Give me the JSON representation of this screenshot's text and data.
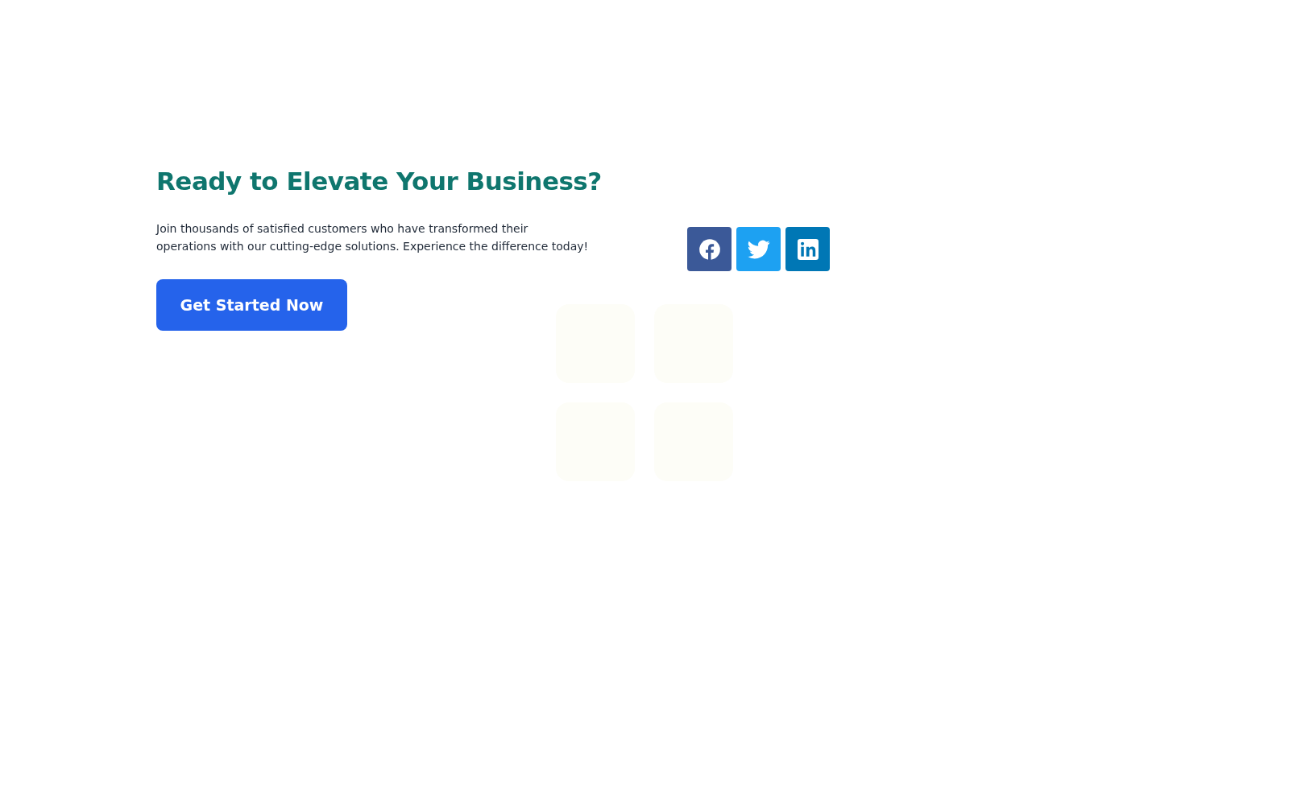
{
  "heading": "Ready to Elevate Your Business?",
  "description": "Join thousands of satisfied customers who have transformed their operations with our cutting-edge solutions. Experience the difference today!",
  "cta_button": "Get Started Now",
  "social_links": [
    {
      "kind": "facebook",
      "color": "#3b5998"
    },
    {
      "kind": "twitter",
      "color": "#1da1f2"
    },
    {
      "kind": "linkedin",
      "color": "#0077b5"
    }
  ]
}
